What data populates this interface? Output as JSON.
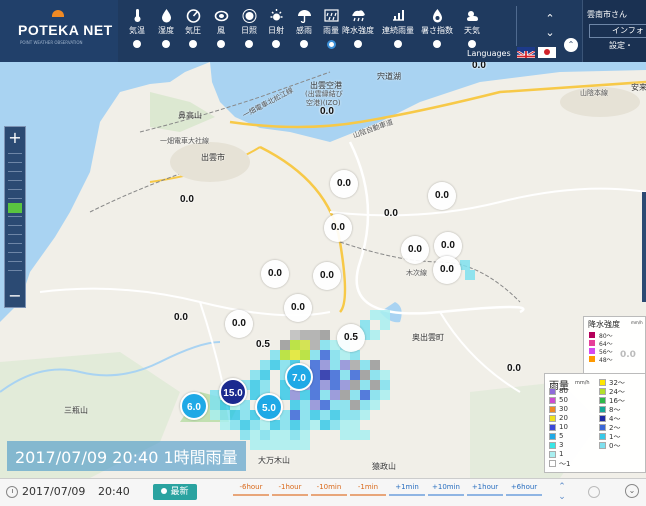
{
  "app": {
    "logo": "POTEKA NET",
    "logo_sub": "POINT WEATHER OBSERVATION"
  },
  "params": [
    {
      "label": "気温",
      "icon": "thermometer-icon"
    },
    {
      "label": "湿度",
      "icon": "humidity-icon"
    },
    {
      "label": "気圧",
      "icon": "pressure-icon"
    },
    {
      "label": "風",
      "icon": "wind-icon"
    },
    {
      "label": "日照",
      "icon": "sunshine-icon"
    },
    {
      "label": "日射",
      "icon": "solar-icon"
    },
    {
      "label": "感雨",
      "icon": "umbrella-icon"
    },
    {
      "label": "雨量",
      "icon": "rainfall-icon",
      "active": true
    },
    {
      "label": "降水強度",
      "icon": "rain-intensity-icon"
    },
    {
      "label": "連続雨量",
      "icon": "continuous-rain-icon"
    },
    {
      "label": "暑さ指数",
      "icon": "heat-index-icon"
    },
    {
      "label": "天気",
      "icon": "weather-icon"
    }
  ],
  "header": {
    "languages_label": "Languages",
    "user_name": "雲南市さん",
    "info_label": "インフォ",
    "settings_label": "設定・"
  },
  "map": {
    "labels": {
      "airport": "出雲空港",
      "airport_sub1": "(出雲縁結び",
      "airport_sub2": "空港)(IZO)",
      "shinjiko": "宍道湖",
      "hanatakayama": "鼻高山",
      "izumo_city": "出雲市",
      "ichihata1": "一畑電車北松江線",
      "ichihata2": "一畑電車大社線",
      "sanin_exp": "山陰自動車道",
      "sanin_main": "山陰本線",
      "kisuki": "木次線",
      "okuizumo": "奥出雲町",
      "sanbesan": "三瓶山",
      "omanki": "大万木山",
      "sarumasayama": "猿政山",
      "yasugi": "安来"
    },
    "values": [
      {
        "text": "0.0",
        "style": "plain"
      },
      {
        "text": "0.0",
        "style": "plain"
      },
      {
        "text": "0.0",
        "style": "plain"
      },
      {
        "text": "0.0",
        "style": "bubble"
      },
      {
        "text": "0.0",
        "style": "bubble"
      },
      {
        "text": "0.0",
        "style": "plain"
      },
      {
        "text": "0.0",
        "style": "bubble"
      },
      {
        "text": "0.0",
        "style": "bubble"
      },
      {
        "text": "0.0",
        "style": "bubble"
      },
      {
        "text": "0.0",
        "style": "bubble"
      },
      {
        "text": "0.0",
        "style": "bubble"
      },
      {
        "text": "0.0",
        "style": "bubble"
      },
      {
        "text": "0.0",
        "style": "bubble"
      },
      {
        "text": "0.0",
        "style": "plain"
      },
      {
        "text": "0.0",
        "style": "bubble"
      },
      {
        "text": "0.5",
        "style": "plain"
      },
      {
        "text": "0.5",
        "style": "bubble"
      },
      {
        "text": "0.0",
        "style": "plain"
      },
      {
        "text": "7.0",
        "style": "cyan"
      },
      {
        "text": "6.0",
        "style": "cyan"
      },
      {
        "text": "15.0",
        "style": "navy"
      },
      {
        "text": "5.0",
        "style": "cyan"
      }
    ]
  },
  "legend_intensity": {
    "title": "降水強度",
    "unit": "mm/h",
    "items": [
      {
        "label": "80～",
        "color": "#b4005a"
      },
      {
        "label": "64～",
        "color": "#e6409a"
      },
      {
        "label": "56～",
        "color": "#d44af0"
      },
      {
        "label": "48～",
        "color": "#ff9900"
      }
    ],
    "value": "0.0"
  },
  "legend_rain": {
    "title": "雨量",
    "unit": "mm/h",
    "left": [
      {
        "label": "80",
        "color": "#8e6bd9"
      },
      {
        "label": "50",
        "color": "#cc4bd0"
      },
      {
        "label": "30",
        "color": "#f08a24"
      },
      {
        "label": "20",
        "color": "#f0e21e"
      },
      {
        "label": "10",
        "color": "#3c49d8"
      },
      {
        "label": "5",
        "color": "#1fa9e6"
      },
      {
        "label": "3",
        "color": "#38e6e6"
      },
      {
        "label": "1",
        "color": "#a8eef0"
      },
      {
        "label": "～1",
        "color": "#ffffff"
      }
    ],
    "right": [
      {
        "label": "32～",
        "color": "#ffe600"
      },
      {
        "label": "24～",
        "color": "#b3e02b"
      },
      {
        "label": "16～",
        "color": "#2fb84a"
      },
      {
        "label": "8～",
        "color": "#16a898"
      },
      {
        "label": "4～",
        "color": "#1f2aa8"
      },
      {
        "label": "2～",
        "color": "#3a67d8"
      },
      {
        "label": "1～",
        "color": "#37c9e8"
      },
      {
        "label": "0～",
        "color": "#7fe0ee"
      }
    ]
  },
  "overlay": {
    "datetime": "2017/07/09 20:40 1時間雨量"
  },
  "bottom": {
    "date": "2017/07/09",
    "time": "20:40",
    "latest_label": "最新",
    "steps": [
      "-6hour",
      "-1hour",
      "-10min",
      "-1min",
      "+1min",
      "+10min",
      "+1hour",
      "+6hour"
    ]
  }
}
